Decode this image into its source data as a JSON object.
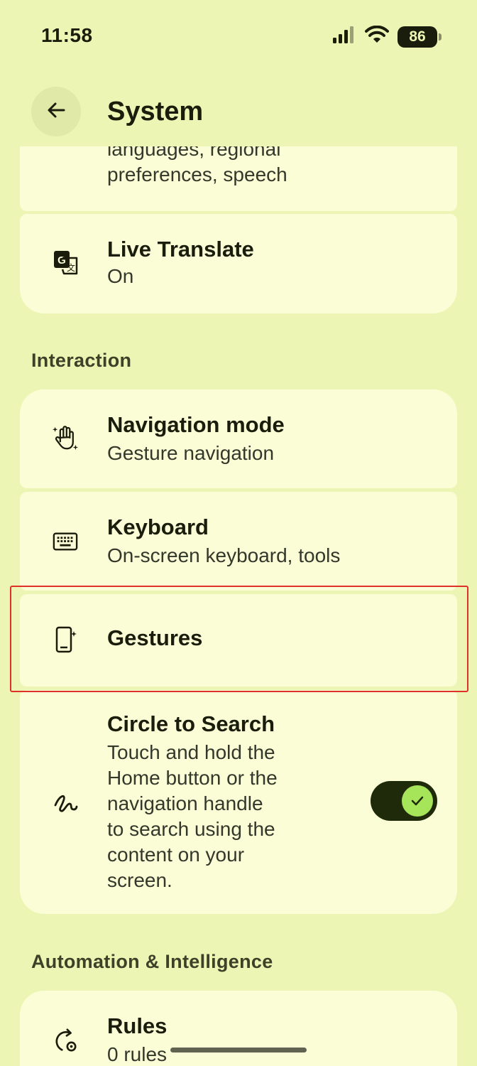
{
  "status_bar": {
    "time": "11:58",
    "battery": "86",
    "icons": [
      "signal-icon",
      "wifi-icon",
      "battery-icon"
    ]
  },
  "app_bar": {
    "title": "System",
    "back_icon": "arrow-back-icon"
  },
  "top_card": {
    "partial_item": {
      "subtitle_line1": "languages, regional",
      "subtitle_line2": "preferences, speech"
    },
    "live_translate": {
      "title": "Live Translate",
      "subtitle": "On",
      "icon": "translate-icon"
    }
  },
  "interaction": {
    "header": "Interaction",
    "items": [
      {
        "title": "Navigation mode",
        "subtitle": "Gesture navigation",
        "icon": "gesture-hand-icon"
      },
      {
        "title": "Keyboard",
        "subtitle": "On-screen keyboard, tools",
        "icon": "keyboard-icon"
      },
      {
        "title": "Gestures",
        "subtitle": "",
        "icon": "phone-sparkle-icon"
      },
      {
        "title": "Circle to Search",
        "subtitle_lines": [
          "Touch and hold the",
          "Home button or the",
          "navigation handle",
          "to search using the",
          "content on your",
          "screen."
        ],
        "icon": "circle-search-icon",
        "toggle_on": true
      }
    ]
  },
  "automation": {
    "header": "Automation & Intelligence",
    "items": [
      {
        "title": "Rules",
        "subtitle": "0 rules",
        "icon": "rules-icon"
      }
    ]
  },
  "colors": {
    "background": "#edf5b4",
    "card": "#fbfdd6",
    "highlight": "#e0302a",
    "toggle_knob": "#a6e45a"
  }
}
